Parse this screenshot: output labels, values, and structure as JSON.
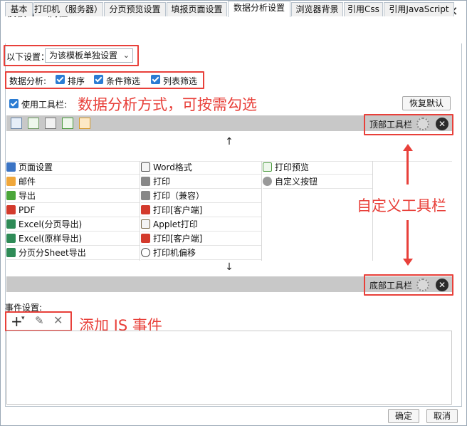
{
  "window": {
    "title": "模板Web属性",
    "close_glyph": "✕"
  },
  "tabs": [
    {
      "label": "基本"
    },
    {
      "label": "打印机（服务器）"
    },
    {
      "label": "分页预览设置"
    },
    {
      "label": "填报页面设置"
    },
    {
      "label": "数据分析设置",
      "active": true
    },
    {
      "label": "浏览器背景"
    },
    {
      "label": "引用Css"
    },
    {
      "label": "引用JavaScript"
    }
  ],
  "settings": {
    "label": "以下设置：",
    "select_value": "为该模板单独设置"
  },
  "analysis": {
    "label": "数据分析:",
    "options": [
      "排序",
      "条件筛选",
      "列表筛选"
    ]
  },
  "toolbar": {
    "use_label": "使用工具栏:",
    "restore_label": "恢复默认",
    "top_label": "顶部工具栏",
    "bottom_label": "底部工具栏",
    "up_arrow": "↑",
    "down_arrow": "↓"
  },
  "annotations": {
    "analysis_mode": "数据分析方式，可按需勾选",
    "custom_toolbar": "自定义工具栏",
    "add_js": "添加 JS 事件"
  },
  "buttons": {
    "col1": [
      "页面设置",
      "邮件",
      "导出",
      "PDF",
      "Excel(分页导出)",
      "Excel(原样导出)",
      "分页分Sheet导出"
    ],
    "col2": [
      "Word格式",
      "打印",
      "打印（兼容）",
      "打印[客户端]",
      "Applet打印",
      "打印[客户端]",
      "打印机偏移"
    ],
    "col3": [
      "打印预览",
      "自定义按钮"
    ]
  },
  "events": {
    "label": "事件设置:",
    "add_glyph": "+",
    "dropdown_glyph": "▾",
    "edit_glyph": "✎",
    "delete_glyph": "✕"
  },
  "footer": {
    "ok": "确定",
    "cancel": "取消"
  },
  "colors": {
    "annotation_red": "#e8403a",
    "checkbox_blue": "#2b7cd3",
    "toolbar_gray": "#c8c8c8"
  }
}
